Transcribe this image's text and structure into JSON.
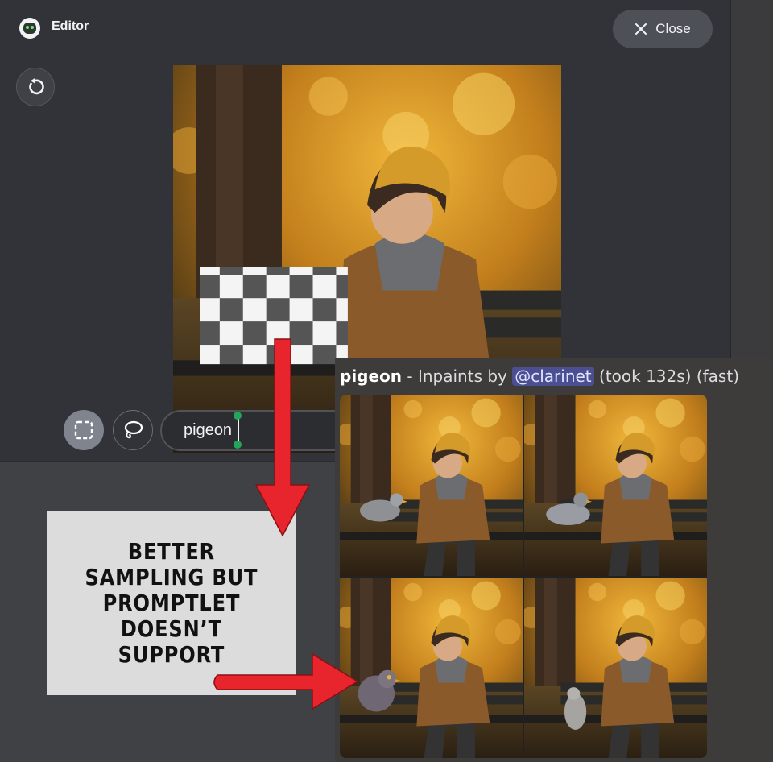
{
  "app": {
    "title": "Editor",
    "icon": "robot-avatar-icon"
  },
  "toolbar": {
    "close_label": "Close",
    "close_icon": "close-icon",
    "reset_icon": "reset-icon"
  },
  "tools": {
    "rect_select_icon": "rect-select-icon",
    "lasso_icon": "lasso-icon"
  },
  "prompt": {
    "value": "pigeon"
  },
  "annotation": {
    "text": "BETTER\nSAMPLING BUT\nPROMPTLET\nDOESN’T\nSUPPORT"
  },
  "result": {
    "prompt": "pigeon",
    "separator": " - Inpaints by ",
    "mention": "@clarinet",
    "took": " (took 132s)",
    "mode": " (fast)",
    "images": [
      "variant-1",
      "variant-2",
      "variant-3",
      "variant-4"
    ]
  },
  "colors": {
    "editor_bg": "#313338",
    "close_button": "#4e5058",
    "mention_bg": "#4b4f92",
    "arrow_red": "#e8242c",
    "caret_handle": "#23a55a"
  }
}
